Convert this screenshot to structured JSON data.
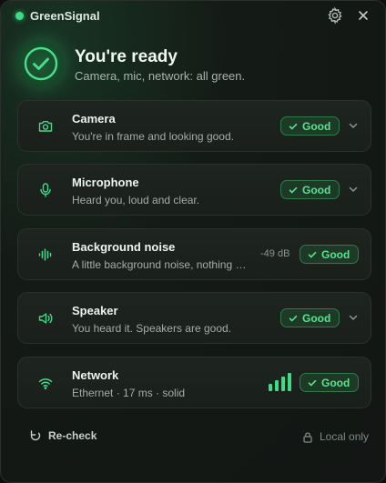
{
  "app": {
    "title": "GreenSignal",
    "status_color": "#3ddc84"
  },
  "header": {
    "settings_icon": "gear-icon",
    "close_icon": "close-icon"
  },
  "hero": {
    "title": "You're ready",
    "subtitle": "Camera, mic, network: all green."
  },
  "checks": [
    {
      "name": "Camera",
      "desc": "You're in frame and looking good.",
      "status": "Good",
      "icon": "camera-icon",
      "expandable": true
    },
    {
      "name": "Microphone",
      "desc": "Heard you, loud and clear.",
      "status": "Good",
      "icon": "microphone-icon",
      "expandable": true
    },
    {
      "name": "Background noise",
      "desc": "A little background noise, nothing to worry about.",
      "status": "Good",
      "icon": "waveform-icon",
      "level": "-49 dB"
    },
    {
      "name": "Speaker",
      "desc": "You heard it. Speakers are good.",
      "status": "Good",
      "icon": "speaker-icon",
      "expandable": true
    },
    {
      "name": "Network",
      "desc": "Ethernet · 17 ms · solid",
      "status": "Good",
      "icon": "wifi-icon",
      "signal_bars": 4
    }
  ],
  "footer": {
    "recheck_label": "Re-check",
    "privacy_label": "Local only"
  },
  "colors": {
    "accent": "#3ddc84",
    "badge_text": "#59e38f",
    "badge_bg": "#1d3a27"
  }
}
